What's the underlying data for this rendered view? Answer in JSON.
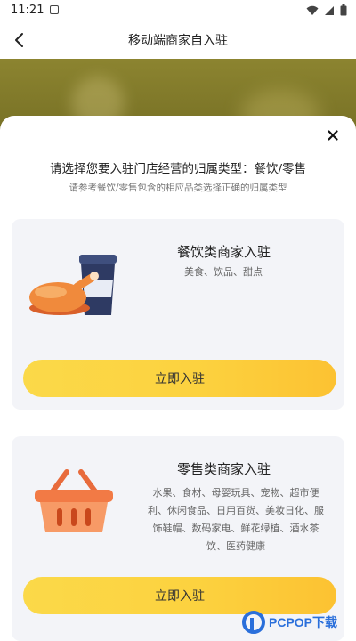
{
  "status_bar": {
    "time": "11:21",
    "icons": [
      "gallery-icon",
      "wifi-icon",
      "signal-icon",
      "battery-icon"
    ]
  },
  "nav": {
    "title": "移动端商家自入驻",
    "back_icon": "chevron-left-icon"
  },
  "sheet": {
    "close_icon": "close-icon",
    "title": "请选择您要入驻门店经营的归属类型：餐饮/零售",
    "subtitle": "请参考餐饮/零售包含的相应品类选择正确的归属类型",
    "cards": [
      {
        "name": "餐饮类商家入驻",
        "categories": "美食、饮品、甜点",
        "illustration": "food-drink-icon",
        "button_label": "立即入驻"
      },
      {
        "name": "零售类商家入驻",
        "categories_lines": [
          "水果、食材、母婴玩具、宠物、超市便",
          "利、休闲食品、日用百货、美妆日化、服",
          "饰鞋帽、数码家电、鲜花绿植、酒水茶",
          "饮、医药健康"
        ],
        "illustration": "shopping-basket-icon",
        "button_label": "立即入驻"
      }
    ]
  },
  "watermark": {
    "text": "PCPOP下载",
    "icon": "pcpop-logo-icon"
  },
  "colors": {
    "accent_yellow": "#fcd23f",
    "card_bg": "#f3f4f8",
    "banner": "#7d7628",
    "watermark_blue": "#2a6fdb"
  }
}
